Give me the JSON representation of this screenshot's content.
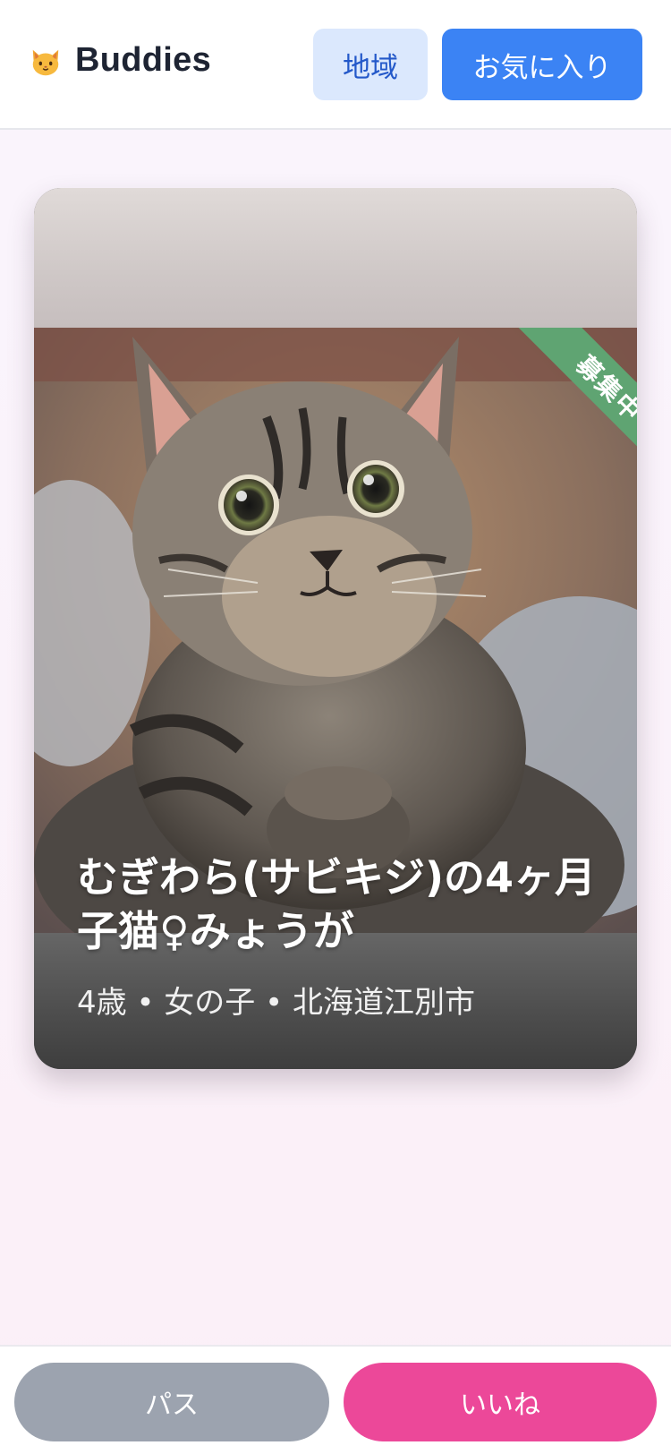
{
  "header": {
    "logo_icon": "cat-face-emoji",
    "app_title": "Buddies",
    "region_button": "地域",
    "favorites_button": "お気に入り"
  },
  "card": {
    "status_ribbon": "募集中",
    "title": "むぎわら(サビキジ)の4ヶ月子猫♀みょうが",
    "meta": "4歳 • 女の子 • 北海道江別市",
    "photo_description_icon": "tabby-kitten-photo"
  },
  "actions": {
    "pass_label": "パス",
    "like_label": "いいね"
  },
  "colors": {
    "primary_blue": "#3b83f4",
    "light_blue": "#dbe8fd",
    "pink": "#ec4899",
    "gray": "#9ca3af",
    "ribbon_green": "#5fa472"
  }
}
